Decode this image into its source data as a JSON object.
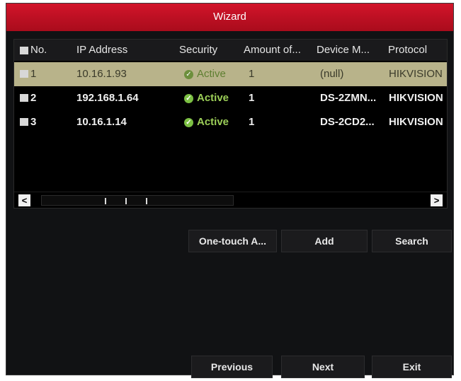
{
  "window": {
    "title": "Wizard"
  },
  "table": {
    "headers": {
      "no": "No.",
      "ip": "IP Address",
      "security": "Security",
      "amount": "Amount of...",
      "model": "Device M...",
      "protocol": "Protocol"
    },
    "rows": [
      {
        "no": "1",
        "ip": "10.16.1.93",
        "security": "Active",
        "amount": "1",
        "model": "(null)",
        "protocol": "HIKVISION",
        "selected": true
      },
      {
        "no": "2",
        "ip": "192.168.1.64",
        "security": "Active",
        "amount": "1",
        "model": "DS-2ZMN...",
        "protocol": "HIKVISION",
        "selected": false
      },
      {
        "no": "3",
        "ip": "10.16.1.14",
        "security": "Active",
        "amount": "1",
        "model": "DS-2CD2...",
        "protocol": "HIKVISION",
        "selected": false
      }
    ],
    "scroll": {
      "left_arrow": "<",
      "right_arrow": ">"
    }
  },
  "actions": {
    "one_touch": "One-touch A...",
    "add": "Add",
    "search": "Search"
  },
  "footer": {
    "previous": "Previous",
    "next": "Next",
    "exit": "Exit"
  },
  "colors": {
    "title_bar": "#c8102e",
    "selected_row": "#b8b38a",
    "active_status": "#7cc043"
  },
  "icons": [
    "checkbox-icon",
    "active-check-icon",
    "scroll-left-icon",
    "scroll-right-icon"
  ]
}
